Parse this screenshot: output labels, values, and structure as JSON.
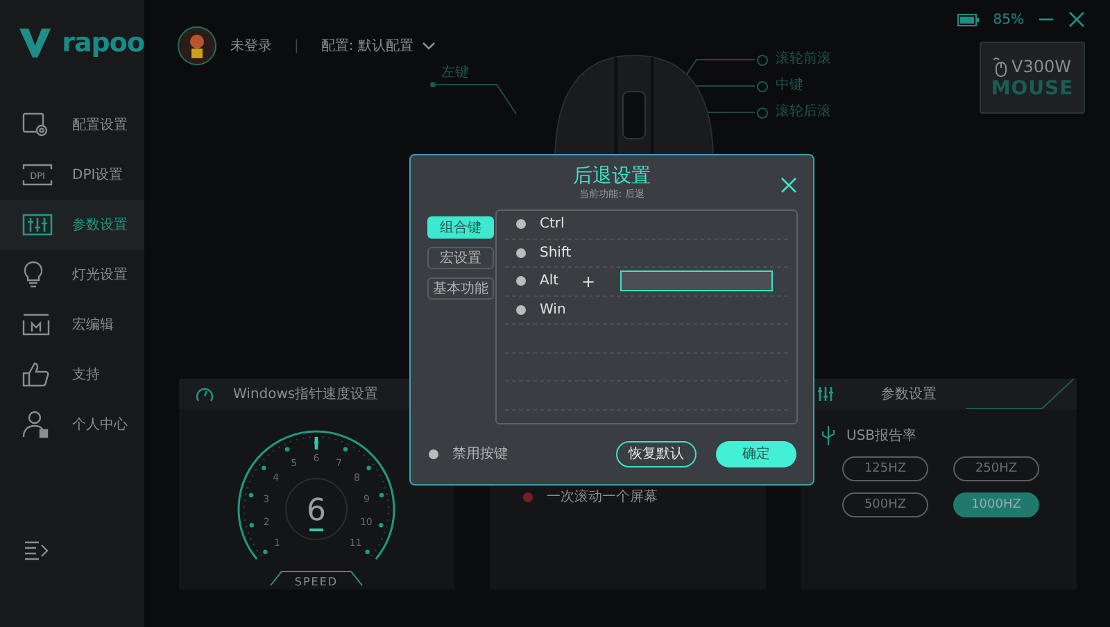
{
  "brand": {
    "name": "rapoo"
  },
  "sidebar": {
    "items": [
      {
        "label": "配置设置",
        "selected": false
      },
      {
        "label": "DPI设置",
        "selected": false,
        "icon_text": "DPI"
      },
      {
        "label": "参数设置",
        "selected": true
      },
      {
        "label": "灯光设置",
        "selected": false
      },
      {
        "label": "宏编辑",
        "selected": false
      },
      {
        "label": "支持",
        "selected": false
      },
      {
        "label": "个人中心",
        "selected": false
      }
    ]
  },
  "header": {
    "user": "未登录",
    "separator": "|",
    "profile": "配置: 默认配置"
  },
  "status": {
    "battery_text": "85%"
  },
  "device": {
    "model": "V300W",
    "type": "MOUSE"
  },
  "mouse_labels": [
    {
      "label": "左键"
    },
    {
      "label": "滚轮前滚"
    },
    {
      "label": "中键"
    },
    {
      "label": "滚轮后滚"
    }
  ],
  "speed_panel": {
    "title": "Windows指针速度设置",
    "value": "6",
    "level": 0.5,
    "scale": [
      "1",
      "2",
      "3",
      "4",
      "5",
      "6",
      "7",
      "8",
      "9",
      "10",
      "11"
    ],
    "caption": "SPEED"
  },
  "scroll_panel": {
    "options": [
      {
        "label": "一次滚动一个屏幕",
        "selected": false
      }
    ]
  },
  "param_panel": {
    "title": "参数设置",
    "usb_label": "USB报告率",
    "rates": [
      {
        "label": "125HZ",
        "selected": false
      },
      {
        "label": "250HZ",
        "selected": false
      },
      {
        "label": "500HZ",
        "selected": false
      },
      {
        "label": "1000HZ",
        "selected": true
      }
    ]
  },
  "dialog": {
    "title": "后退设置",
    "subtitle": "当前功能: 后退",
    "tabs": [
      {
        "label": "组合键",
        "selected": true
      },
      {
        "label": "宏设置",
        "selected": false
      },
      {
        "label": "基本功能",
        "selected": false
      }
    ],
    "keys": [
      {
        "label": "Ctrl",
        "checked": false
      },
      {
        "label": "Shift",
        "checked": false
      },
      {
        "label": "Alt",
        "checked": false,
        "combo": "+"
      },
      {
        "label": "Win",
        "checked": false
      }
    ],
    "disable_key": {
      "label": "禁用按键",
      "checked": false
    },
    "buttons": [
      {
        "label": "恢复默认",
        "kind": "secondary"
      },
      {
        "label": "确定",
        "kind": "primary"
      }
    ]
  }
}
